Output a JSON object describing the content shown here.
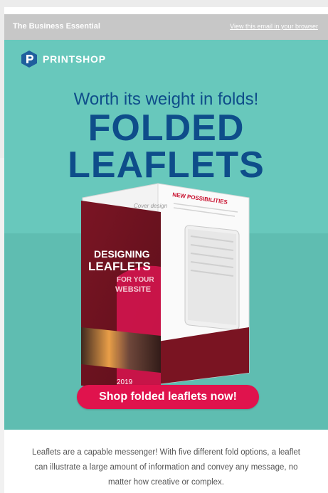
{
  "header": {
    "left_label": "The Business Essential",
    "right_link": "View this email in your browser"
  },
  "brand": {
    "logo_text": "PRINTSHOP",
    "logo_color": "#1f5f9d"
  },
  "hero": {
    "tagline": "Worth its weight in folds!",
    "headline_line1": "FOLDED",
    "headline_line2": "LEAFLETS",
    "bg_color": "#68c8bc",
    "headline_color": "#0e4d8a"
  },
  "leaflet": {
    "cover_title_1": "DESIGNING",
    "cover_title_2": "LEAFLETS",
    "cover_title_3": "FOR YOUR",
    "cover_title_4": "WEBSITE",
    "cover_label": "Cover design",
    "inner_heading": "NEW POSSIBILITIES",
    "year": "2019"
  },
  "cta": {
    "label": "Shop folded leaflets now!",
    "color": "#e0134d"
  },
  "body": {
    "line1": "Leaflets are a capable messenger! With five different fold options, a leaflet",
    "line2": "can illustrate a large amount of information and convey any message, no",
    "line3": "matter how creative or complex."
  }
}
